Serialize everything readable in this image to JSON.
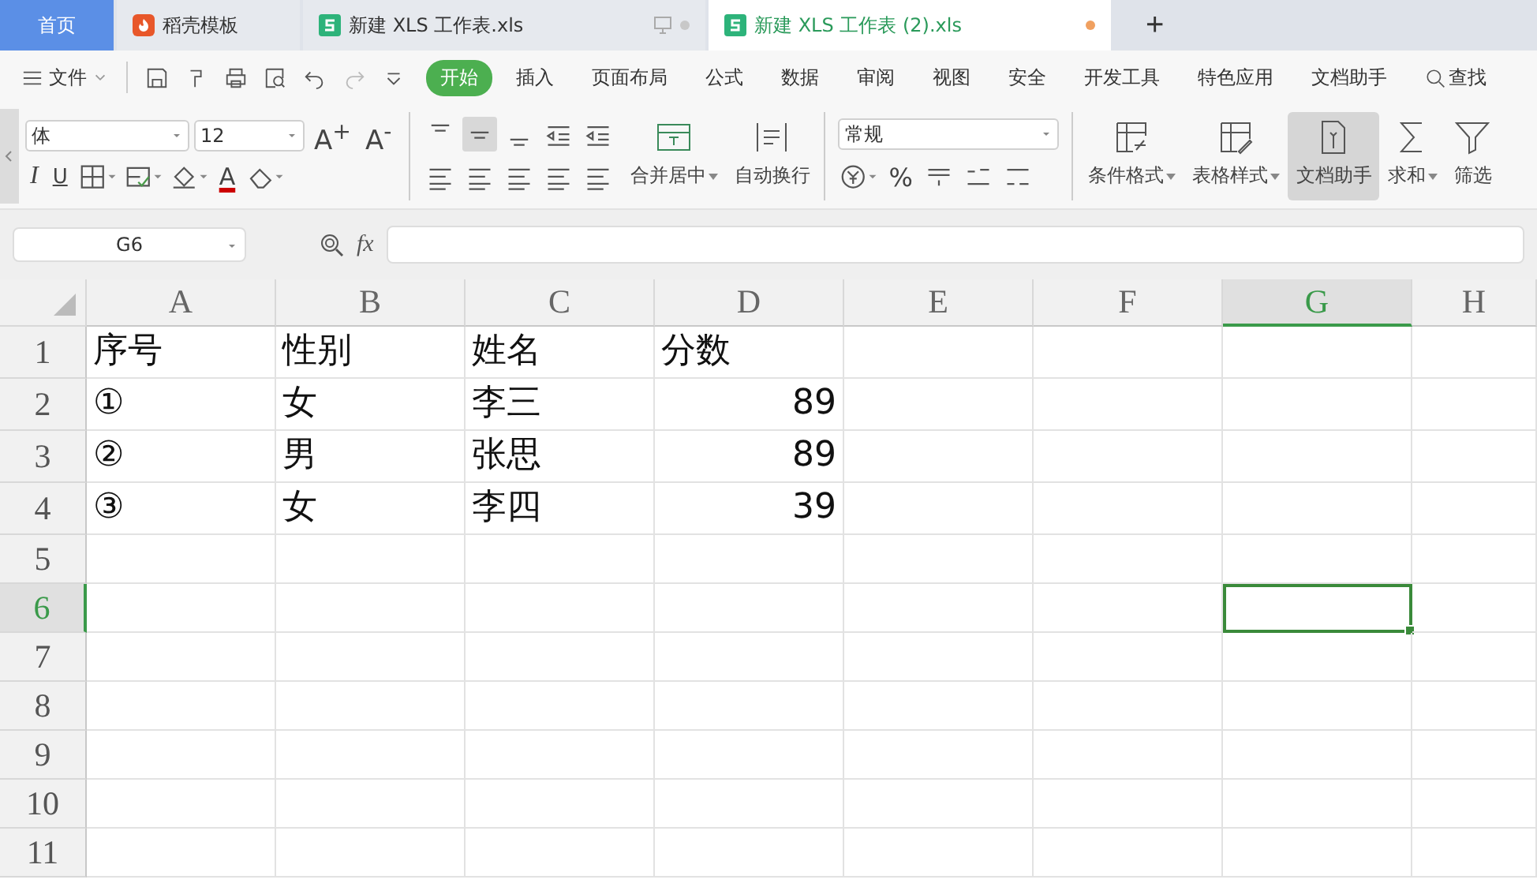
{
  "tabs": [
    {
      "label": "首页",
      "kind": "home",
      "selected": false
    },
    {
      "label": "稻壳模板",
      "kind": "docer",
      "selected": false
    },
    {
      "label": "新建 XLS 工作表.xls",
      "kind": "sheet",
      "selected": false,
      "modified": false
    },
    {
      "label": "新建 XLS 工作表 (2).xls",
      "kind": "sheet",
      "selected": true,
      "modified": true
    }
  ],
  "new_tab": "+",
  "file_menu": "文件",
  "menu": [
    {
      "label": "开始",
      "selected": true
    },
    {
      "label": "插入",
      "selected": false
    },
    {
      "label": "页面布局",
      "selected": false
    },
    {
      "label": "公式",
      "selected": false
    },
    {
      "label": "数据",
      "selected": false
    },
    {
      "label": "审阅",
      "selected": false
    },
    {
      "label": "视图",
      "selected": false
    },
    {
      "label": "安全",
      "selected": false
    },
    {
      "label": "开发工具",
      "selected": false
    },
    {
      "label": "特色应用",
      "selected": false
    },
    {
      "label": "文档助手",
      "selected": false
    }
  ],
  "search": "查找",
  "font_name": "体",
  "font_size": "12",
  "font_grow": "A$^{+}$",
  "font_shrink": "A$^{-}$",
  "italic": "I",
  "underline": "U",
  "font_color": "A",
  "number_format": "常规",
  "percent": "%",
  "big_buttons": [
    {
      "label": "合并居中",
      "kind": "merge",
      "dropdown": true,
      "selected": false
    },
    {
      "label": "自动换行",
      "kind": "wrap",
      "dropdown": false,
      "selected": false
    }
  ],
  "style_buttons": [
    {
      "label": "条件格式",
      "kind": "conditional",
      "dropdown": true,
      "selected": false
    },
    {
      "label": "表格样式",
      "kind": "table",
      "dropdown": true,
      "selected": false
    },
    {
      "label": "文档助手",
      "kind": "assistant",
      "dropdown": false,
      "selected": true
    },
    {
      "label": "求和",
      "kind": "sum",
      "dropdown": true,
      "selected": false
    },
    {
      "label": "筛选",
      "kind": "filter",
      "dropdown": false,
      "selected": false
    }
  ],
  "name_box": "G6",
  "fx": "fx",
  "columns": [
    {
      "label": "A",
      "selected": false
    },
    {
      "label": "B",
      "selected": false
    },
    {
      "label": "C",
      "selected": false
    },
    {
      "label": "D",
      "selected": false
    },
    {
      "label": "E",
      "selected": false
    },
    {
      "label": "F",
      "selected": false
    },
    {
      "label": "G",
      "selected": true
    },
    {
      "label": "H",
      "selected": false
    }
  ],
  "rows": [
    {
      "header": "1",
      "selected": false,
      "cells": [
        {
          "text": "序号",
          "kind": "text"
        },
        {
          "text": "性别",
          "kind": "text"
        },
        {
          "text": "姓名",
          "kind": "text"
        },
        {
          "text": "分数",
          "kind": "text"
        }
      ]
    },
    {
      "header": "2",
      "selected": false,
      "cells": [
        {
          "text": "①",
          "kind": "text"
        },
        {
          "text": "女",
          "kind": "text"
        },
        {
          "text": "李三",
          "kind": "text"
        },
        {
          "text": "89",
          "kind": "number"
        }
      ]
    },
    {
      "header": "3",
      "selected": false,
      "cells": [
        {
          "text": "②",
          "kind": "text"
        },
        {
          "text": "男",
          "kind": "text"
        },
        {
          "text": "张思",
          "kind": "text"
        },
        {
          "text": "89",
          "kind": "number"
        }
      ]
    },
    {
      "header": "4",
      "selected": false,
      "cells": [
        {
          "text": "③",
          "kind": "text"
        },
        {
          "text": "女",
          "kind": "text"
        },
        {
          "text": "李四",
          "kind": "text"
        },
        {
          "text": "39",
          "kind": "number"
        }
      ]
    },
    {
      "header": "5",
      "selected": false
    },
    {
      "header": "6",
      "selected": true
    },
    {
      "header": "7",
      "selected": false
    },
    {
      "header": "8",
      "selected": false
    },
    {
      "header": "9",
      "selected": false
    },
    {
      "header": "10",
      "selected": false
    },
    {
      "header": "11",
      "selected": false
    }
  ]
}
